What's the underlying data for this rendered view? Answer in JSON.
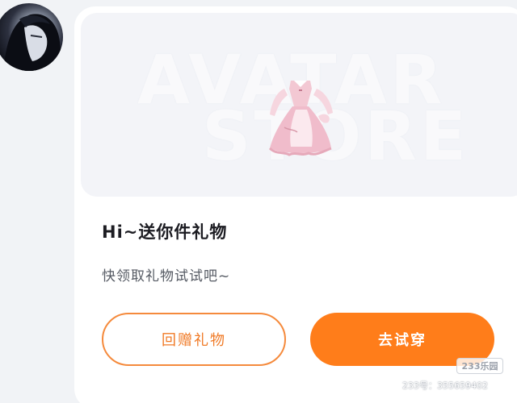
{
  "greeting": {
    "title": "Hi~送你件礼物",
    "subtitle": "快领取礼物试试吧~"
  },
  "banner": {
    "watermark_line1": "AVATAR",
    "watermark_line2": "STORE",
    "item_icon": "dress-icon"
  },
  "buttons": {
    "return_gift_label": "回赠礼物",
    "try_on_label": "去试穿"
  },
  "watermark": {
    "logo": "233乐园",
    "id_text": "233号：355659402"
  },
  "colors": {
    "accent": "#ff7d1a",
    "accent_border": "#f58a3c",
    "card_bg": "#ffffff",
    "page_bg": "#f1f3f6"
  }
}
